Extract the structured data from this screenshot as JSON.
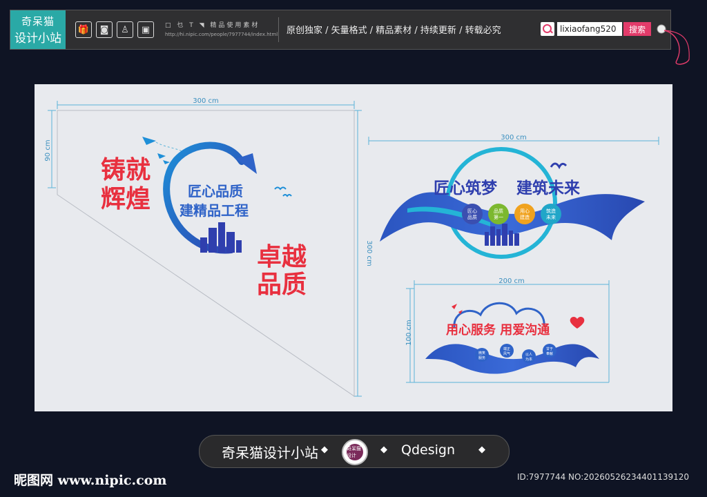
{
  "header": {
    "logo_line1": "奇呆猫",
    "logo_line2": "设计小站",
    "tool_icons": [
      "gift-icon",
      "camera-icon",
      "dress-icon",
      "bag-icon"
    ],
    "mini_glyphs": "□ 乜 T ◥",
    "mini_label": "精品使用素材",
    "mini_url": "http://hi.nipic.com/people/7977744/index.html",
    "slogan": "原创独家 / 矢量格式 / 精品素材 / 持续更新 / 转载必究",
    "search_value": "lixiaofang520",
    "search_button": "搜索"
  },
  "design": {
    "panel1": {
      "width_label": "300 cm",
      "height_label": "90 cm",
      "height2_label": "300 cm",
      "slogan_left_1": "铸就",
      "slogan_left_2": "辉煌",
      "circle_line1": "匠心品质",
      "circle_line2": "建精品工程",
      "slogan_right_1": "卓越",
      "slogan_right_2": "品质"
    },
    "panel2": {
      "width_label": "300 cm",
      "title_a": "匠心筑梦",
      "title_b": "建筑未来",
      "badges": [
        {
          "l1": "匠心",
          "l2": "品质",
          "color": "#3b4fb0"
        },
        {
          "l1": "品质",
          "l2": "第一",
          "color": "#7cb82f"
        },
        {
          "l1": "用心",
          "l2": "建造",
          "color": "#f0a21e"
        },
        {
          "l1": "筑造",
          "l2": "未来",
          "color": "#21a6c8"
        }
      ]
    },
    "panel3": {
      "width_label": "200 cm",
      "height_label": "100 cm",
      "title": "用心服务 用爱沟通",
      "badges": [
        {
          "l1": "微笑",
          "l2": "服务"
        },
        {
          "l1": "端正",
          "l2": "风气"
        },
        {
          "l1": "以人",
          "l2": "为本"
        },
        {
          "l1": "甘于",
          "l2": "奉献"
        }
      ]
    },
    "colors": {
      "blue": "#2f63c8",
      "cyan": "#24b4d6",
      "red": "#e8303f",
      "dim_line": "#5ab3d8"
    }
  },
  "footer": {
    "pill_name": "奇呆猫设计小站",
    "badge_text": "奇呆猫设计",
    "pill_brand": "Qdesign",
    "site_mark": "昵图网 www.nipic.com",
    "image_id": "ID:7977744 NO:20260526234401139120"
  }
}
